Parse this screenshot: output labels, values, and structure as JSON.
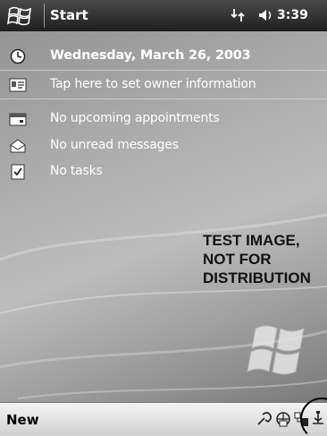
{
  "topbar": {
    "start_label": "Start",
    "time": "3:39",
    "icons": [
      "windows-flag-icon",
      "connectivity-icon",
      "speaker-icon"
    ]
  },
  "today": {
    "date": "Wednesday, March 26, 2003",
    "owner": "Tap here to set owner information",
    "appointments": "No upcoming appointments",
    "messages": "No unread messages",
    "tasks": "No tasks"
  },
  "watermark": {
    "line1": "TEST IMAGE,",
    "line2": "NOT FOR",
    "line3": "DISTRIBUTION"
  },
  "bottombar": {
    "new_label": "New",
    "tray_icons": [
      "sync-icon",
      "network-icon",
      "connection-icon",
      "usb-icon"
    ]
  }
}
